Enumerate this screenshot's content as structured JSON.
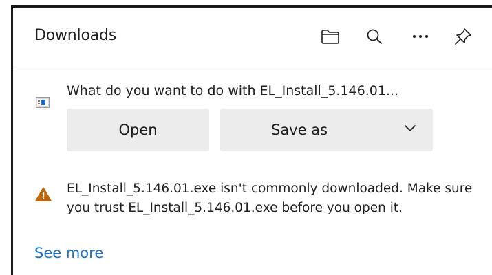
{
  "panel": {
    "title": "Downloads",
    "header_icons": [
      "folder-icon",
      "search-icon",
      "more-icon",
      "pin-icon"
    ]
  },
  "download": {
    "question": "What do you want to do with EL_Install_5.146.01...",
    "open_label": "Open",
    "save_as_label": "Save as",
    "file_icon": "installer-file-icon"
  },
  "warning": {
    "icon": "warning-triangle-icon",
    "text": "EL_Install_5.146.01.exe isn't commonly downloaded. Make sure you trust EL_Install_5.146.01.exe before you open it.",
    "icon_color": "#c0680c"
  },
  "see_more": {
    "label": "See more",
    "color": "#1a73c8"
  }
}
